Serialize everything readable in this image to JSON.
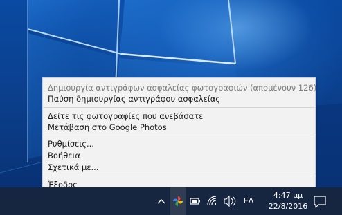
{
  "context_menu": {
    "items": [
      {
        "label": "Δημιουργία αντιγράφων ασφαλείας φωτογραφιών (απομένουν 126)",
        "enabled": false
      },
      {
        "label": "Παύση δημιουργίας αντιγράφου ασφαλείας",
        "enabled": true
      },
      {
        "label": "Δείτε τις φωτογραφίες που ανεβάσατε",
        "enabled": true
      },
      {
        "label": "Μετάβαση στο Google Photos",
        "enabled": true
      },
      {
        "label": "Ρυθμίσεις...",
        "enabled": true
      },
      {
        "label": "Βοήθεια",
        "enabled": true
      },
      {
        "label": "Σχετικά με...",
        "enabled": true
      },
      {
        "label": "Έξοδος",
        "enabled": true
      }
    ]
  },
  "taskbar": {
    "tray_icons": [
      "chevron-up-icon",
      "google-photos-icon",
      "battery-icon",
      "wifi-icon",
      "volume-icon"
    ],
    "language": "ΕΛ",
    "clock": {
      "time": "4:47 μμ",
      "date": "22/8/2016"
    },
    "action_center_icon": "notification-icon"
  },
  "colors": {
    "taskbar_bg": "#162640",
    "menu_bg": "#f2f2f2",
    "desktop_blue": "#0b3f8c"
  }
}
